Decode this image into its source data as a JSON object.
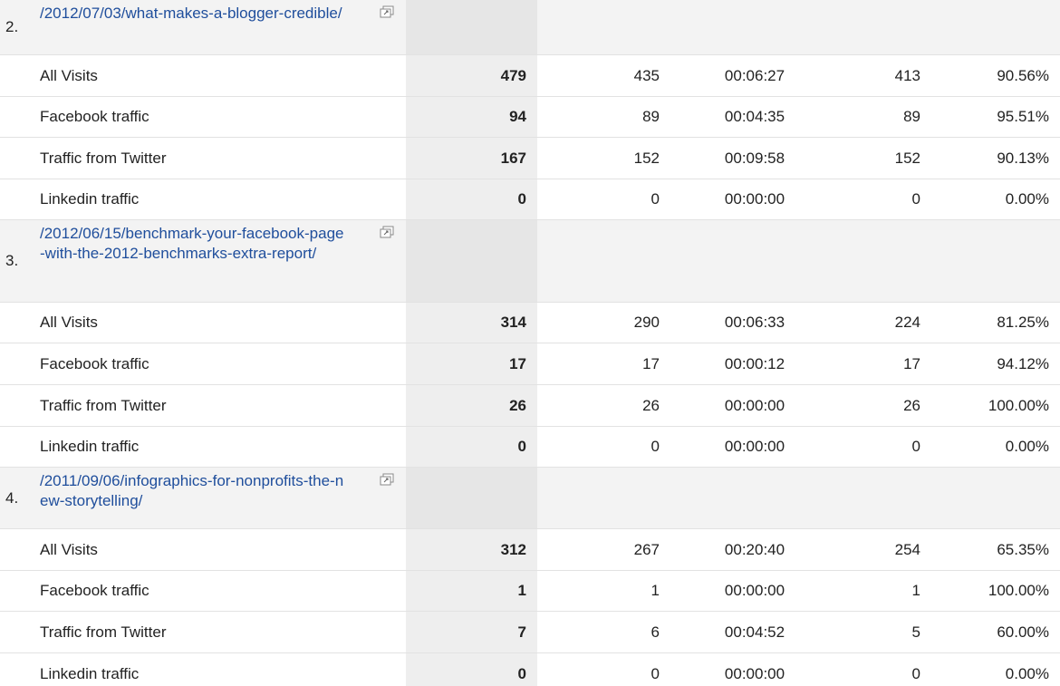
{
  "groups": [
    {
      "index": "2.",
      "page": "/2012/07/03/what-makes-a-blogger-credible/",
      "rows": [
        {
          "label": "All Visits",
          "v1": "479",
          "v2": "435",
          "v3": "00:06:27",
          "v4": "413",
          "v5": "90.56%"
        },
        {
          "label": "Facebook traffic",
          "v1": "94",
          "v2": "89",
          "v3": "00:04:35",
          "v4": "89",
          "v5": "95.51%"
        },
        {
          "label": "Traffic from Twitter",
          "v1": "167",
          "v2": "152",
          "v3": "00:09:58",
          "v4": "152",
          "v5": "90.13%"
        },
        {
          "label": "Linkedin traffic",
          "v1": "0",
          "v2": "0",
          "v3": "00:00:00",
          "v4": "0",
          "v5": "0.00%"
        }
      ]
    },
    {
      "index": "3.",
      "page": "/2012/06/15/benchmark-your-facebook-page-with-the-2012-benchmarks-extra-report/",
      "rows": [
        {
          "label": "All Visits",
          "v1": "314",
          "v2": "290",
          "v3": "00:06:33",
          "v4": "224",
          "v5": "81.25%"
        },
        {
          "label": "Facebook traffic",
          "v1": "17",
          "v2": "17",
          "v3": "00:00:12",
          "v4": "17",
          "v5": "94.12%"
        },
        {
          "label": "Traffic from Twitter",
          "v1": "26",
          "v2": "26",
          "v3": "00:00:00",
          "v4": "26",
          "v5": "100.00%"
        },
        {
          "label": "Linkedin traffic",
          "v1": "0",
          "v2": "0",
          "v3": "00:00:00",
          "v4": "0",
          "v5": "0.00%"
        }
      ]
    },
    {
      "index": "4.",
      "page": "/2011/09/06/infographics-for-nonprofits-the-new-storytelling/",
      "rows": [
        {
          "label": "All Visits",
          "v1": "312",
          "v2": "267",
          "v3": "00:20:40",
          "v4": "254",
          "v5": "65.35%"
        },
        {
          "label": "Facebook traffic",
          "v1": "1",
          "v2": "1",
          "v3": "00:00:00",
          "v4": "1",
          "v5": "100.00%"
        },
        {
          "label": "Traffic from Twitter",
          "v1": "7",
          "v2": "6",
          "v3": "00:04:52",
          "v4": "5",
          "v5": "60.00%"
        },
        {
          "label": "Linkedin traffic",
          "v1": "0",
          "v2": "0",
          "v3": "00:00:00",
          "v4": "0",
          "v5": "0.00%"
        }
      ]
    }
  ],
  "icons": {
    "popout": "external-window-icon"
  },
  "colors": {
    "link": "#1f4e9c",
    "group_bg": "#f3f3f3",
    "primary_col_bg": "#eeeeee"
  }
}
